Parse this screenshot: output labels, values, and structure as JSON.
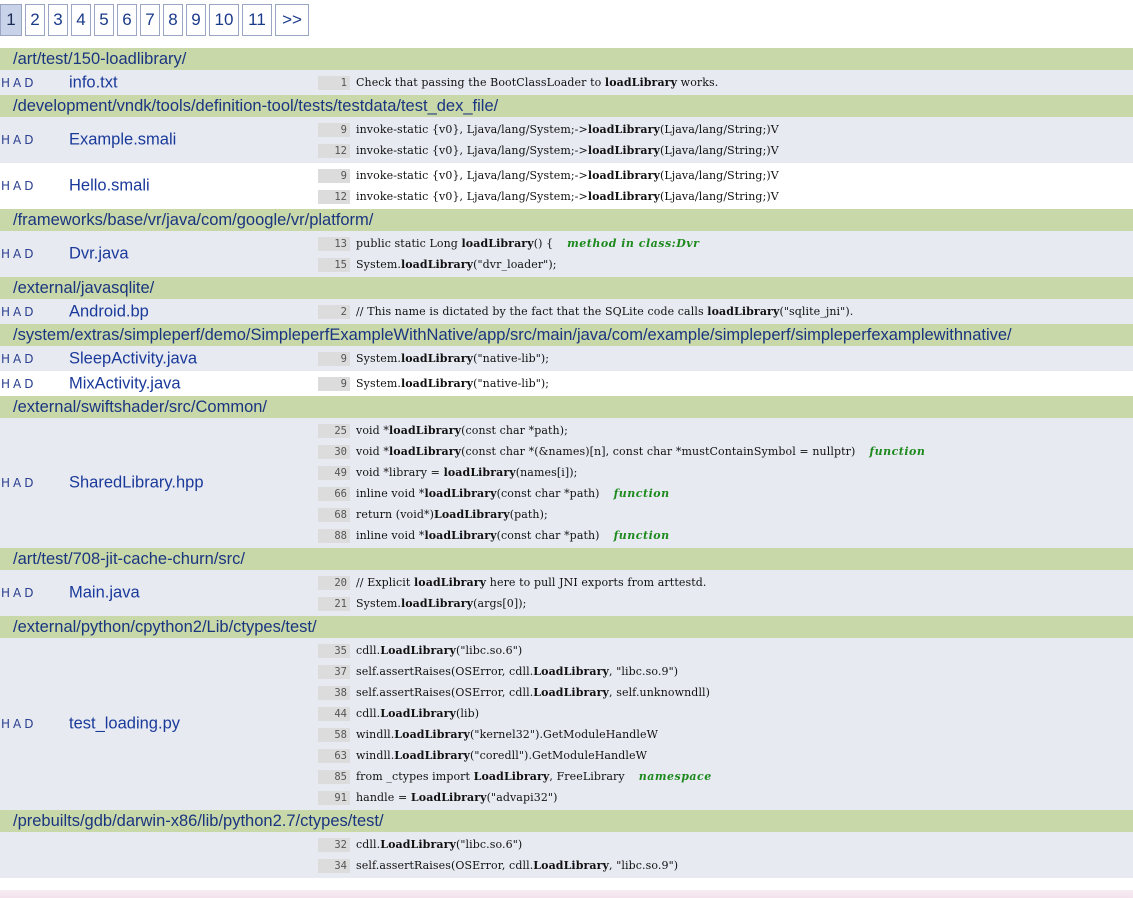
{
  "pagination": {
    "pages": [
      "1",
      "2",
      "3",
      "4",
      "5",
      "6",
      "7",
      "8",
      "9",
      "10",
      "11",
      ">>"
    ],
    "current": "1"
  },
  "groups": [
    {
      "dir": "/art/test/150-loadlibrary/",
      "files": [
        {
          "had": "HAD",
          "name": "info.txt",
          "lines": [
            {
              "n": "1",
              "pre": "Check that passing the BootClassLoader to ",
              "kw": "loadLibrary",
              "post": " works.",
              "tag": ""
            }
          ]
        }
      ]
    },
    {
      "dir": "/development/vndk/tools/definition-tool/tests/testdata/test_dex_file/",
      "files": [
        {
          "had": "HAD",
          "name": "Example.smali",
          "lines": [
            {
              "n": "9",
              "pre": "invoke-static {v0}, Ljava/lang/System;->",
              "kw": "loadLibrary",
              "post": "(Ljava/lang/String;)V",
              "tag": ""
            },
            {
              "n": "12",
              "pre": "invoke-static {v0}, Ljava/lang/System;->",
              "kw": "loadLibrary",
              "post": "(Ljava/lang/String;)V",
              "tag": ""
            }
          ]
        },
        {
          "had": "HAD",
          "name": "Hello.smali",
          "lines": [
            {
              "n": "9",
              "pre": "invoke-static {v0}, Ljava/lang/System;->",
              "kw": "loadLibrary",
              "post": "(Ljava/lang/String;)V",
              "tag": ""
            },
            {
              "n": "12",
              "pre": "invoke-static {v0}, Ljava/lang/System;->",
              "kw": "loadLibrary",
              "post": "(Ljava/lang/String;)V",
              "tag": ""
            }
          ]
        }
      ]
    },
    {
      "dir": "/frameworks/base/vr/java/com/google/vr/platform/",
      "files": [
        {
          "had": "HAD",
          "name": "Dvr.java",
          "lines": [
            {
              "n": "13",
              "pre": "public static Long ",
              "kw": "loadLibrary",
              "post": "() {",
              "tag": "method in class:Dvr"
            },
            {
              "n": "15",
              "pre": "System.",
              "kw": "loadLibrary",
              "post": "(\"dvr_loader\");",
              "tag": ""
            }
          ]
        }
      ]
    },
    {
      "dir": "/external/javasqlite/",
      "files": [
        {
          "had": "HAD",
          "name": "Android.bp",
          "lines": [
            {
              "n": "2",
              "pre": "// This name is dictated by the fact that the SQLite code calls ",
              "kw": "loadLibrary",
              "post": "(\"sqlite_jni\").",
              "tag": ""
            }
          ]
        }
      ]
    },
    {
      "dir": "/system/extras/simpleperf/demo/SimpleperfExampleWithNative/app/src/main/java/com/example/simpleperf/simpleperfexamplewithnative/",
      "files": [
        {
          "had": "HAD",
          "name": "SleepActivity.java",
          "lines": [
            {
              "n": "9",
              "pre": "System.",
              "kw": "loadLibrary",
              "post": "(\"native-lib\");",
              "tag": ""
            }
          ]
        },
        {
          "had": "HAD",
          "name": "MixActivity.java",
          "lines": [
            {
              "n": "9",
              "pre": "System.",
              "kw": "loadLibrary",
              "post": "(\"native-lib\");",
              "tag": ""
            }
          ]
        }
      ]
    },
    {
      "dir": "/external/swiftshader/src/Common/",
      "files": [
        {
          "had": "HAD",
          "name": "SharedLibrary.hpp",
          "lines": [
            {
              "n": "25",
              "pre": "void *",
              "kw": "loadLibrary",
              "post": "(const char *path);",
              "tag": ""
            },
            {
              "n": "30",
              "pre": "void *",
              "kw": "loadLibrary",
              "post": "(const char *(&names)[n], const char *mustContainSymbol = nullptr)",
              "tag": "function"
            },
            {
              "n": "49",
              "pre": "void *library = ",
              "kw": "loadLibrary",
              "post": "(names[i]);",
              "tag": ""
            },
            {
              "n": "66",
              "pre": "inline void *",
              "kw": "loadLibrary",
              "post": "(const char *path)",
              "tag": "function"
            },
            {
              "n": "68",
              "pre": "return (void*)",
              "kw": "LoadLibrary",
              "post": "(path);",
              "tag": ""
            },
            {
              "n": "88",
              "pre": "inline void *",
              "kw": "loadLibrary",
              "post": "(const char *path)",
              "tag": "function"
            }
          ]
        }
      ]
    },
    {
      "dir": "/art/test/708-jit-cache-churn/src/",
      "files": [
        {
          "had": "HAD",
          "name": "Main.java",
          "lines": [
            {
              "n": "20",
              "pre": "// Explicit ",
              "kw": "loadLibrary",
              "post": " here to pull JNI exports from arttestd.",
              "tag": ""
            },
            {
              "n": "21",
              "pre": "System.",
              "kw": "loadLibrary",
              "post": "(args[0]);",
              "tag": ""
            }
          ]
        }
      ]
    },
    {
      "dir": "/external/python/cpython2/Lib/ctypes/test/",
      "files": [
        {
          "had": "HAD",
          "name": "test_loading.py",
          "lines": [
            {
              "n": "35",
              "pre": "cdll.",
              "kw": "LoadLibrary",
              "post": "(\"libc.so.6\")",
              "tag": ""
            },
            {
              "n": "37",
              "pre": "self.assertRaises(OSError, cdll.",
              "kw": "LoadLibrary",
              "post": ", \"libc.so.9\")",
              "tag": ""
            },
            {
              "n": "38",
              "pre": "self.assertRaises(OSError, cdll.",
              "kw": "LoadLibrary",
              "post": ", self.unknowndll)",
              "tag": ""
            },
            {
              "n": "44",
              "pre": "cdll.",
              "kw": "LoadLibrary",
              "post": "(lib)",
              "tag": ""
            },
            {
              "n": "58",
              "pre": "windll.",
              "kw": "LoadLibrary",
              "post": "(\"kernel32\").GetModuleHandleW",
              "tag": ""
            },
            {
              "n": "63",
              "pre": "windll.",
              "kw": "LoadLibrary",
              "post": "(\"coredll\").GetModuleHandleW",
              "tag": ""
            },
            {
              "n": "85",
              "pre": "from _ctypes import ",
              "kw": "LoadLibrary",
              "post": ", FreeLibrary",
              "tag": "namespace"
            },
            {
              "n": "91",
              "pre": "handle = ",
              "kw": "LoadLibrary",
              "post": "(\"advapi32\")",
              "tag": ""
            }
          ]
        }
      ]
    },
    {
      "dir": "/prebuilts/gdb/darwin-x86/lib/python2.7/ctypes/test/",
      "files": [
        {
          "had": "",
          "name": "",
          "lines": [
            {
              "n": "32",
              "pre": "cdll.",
              "kw": "LoadLibrary",
              "post": "(\"libc.so.6\")",
              "tag": ""
            },
            {
              "n": "34",
              "pre": "self.assertRaises(OSError, cdll.",
              "kw": "LoadLibrary",
              "post": ", \"libc.so.9\")",
              "tag": ""
            }
          ]
        }
      ]
    }
  ]
}
